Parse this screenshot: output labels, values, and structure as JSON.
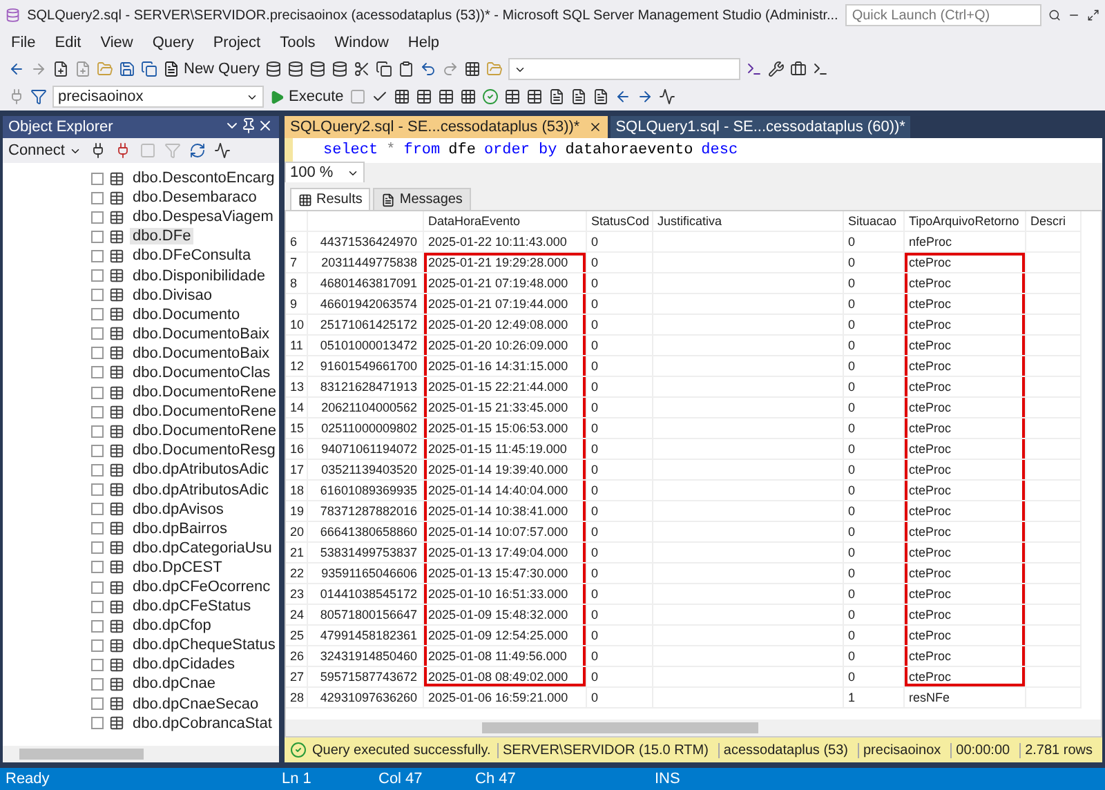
{
  "window": {
    "title": "SQLQuery2.sql - SERVER\\SERVIDOR.precisaoinox (acessodataplus (53))* - Microsoft SQL Server Management Studio (Administr..."
  },
  "quick_launch": {
    "placeholder": "Quick Launch (Ctrl+Q)"
  },
  "menu": [
    "File",
    "Edit",
    "View",
    "Query",
    "Project",
    "Tools",
    "Window",
    "Help"
  ],
  "toolbar": {
    "new_query": "New Query",
    "database": "precisaoinox",
    "execute": "Execute"
  },
  "object_explorer": {
    "title": "Object Explorer",
    "connect": "Connect",
    "items": [
      {
        "label": "dbo.DescontoEncarg",
        "selected": false
      },
      {
        "label": "dbo.Desembaraco",
        "selected": false
      },
      {
        "label": "dbo.DespesaViagem",
        "selected": false
      },
      {
        "label": "dbo.DFe",
        "selected": true
      },
      {
        "label": "dbo.DFeConsulta",
        "selected": false
      },
      {
        "label": "dbo.Disponibilidade",
        "selected": false
      },
      {
        "label": "dbo.Divisao",
        "selected": false
      },
      {
        "label": "dbo.Documento",
        "selected": false
      },
      {
        "label": "dbo.DocumentoBaix",
        "selected": false
      },
      {
        "label": "dbo.DocumentoBaix",
        "selected": false
      },
      {
        "label": "dbo.DocumentoClas",
        "selected": false
      },
      {
        "label": "dbo.DocumentoRene",
        "selected": false
      },
      {
        "label": "dbo.DocumentoRene",
        "selected": false
      },
      {
        "label": "dbo.DocumentoRene",
        "selected": false
      },
      {
        "label": "dbo.DocumentoResg",
        "selected": false
      },
      {
        "label": "dbo.dpAtributosAdic",
        "selected": false
      },
      {
        "label": "dbo.dpAtributosAdic",
        "selected": false
      },
      {
        "label": "dbo.dpAvisos",
        "selected": false
      },
      {
        "label": "dbo.dpBairros",
        "selected": false
      },
      {
        "label": "dbo.dpCategoriaUsu",
        "selected": false
      },
      {
        "label": "dbo.DpCEST",
        "selected": false
      },
      {
        "label": "dbo.dpCFeOcorrenc",
        "selected": false
      },
      {
        "label": "dbo.dpCFeStatus",
        "selected": false
      },
      {
        "label": "dbo.dpCfop",
        "selected": false
      },
      {
        "label": "dbo.dpChequeStatus",
        "selected": false
      },
      {
        "label": "dbo.dpCidades",
        "selected": false
      },
      {
        "label": "dbo.dpCnae",
        "selected": false
      },
      {
        "label": "dbo.dpCnaeSecao",
        "selected": false
      },
      {
        "label": "dbo.dpCobrancaStat",
        "selected": false
      }
    ]
  },
  "editor_tabs": [
    {
      "label": "SQLQuery2.sql - SE...cessodataplus (53))*",
      "selected": true
    },
    {
      "label": "SQLQuery1.sql - SE...cessodataplus (60))*",
      "selected": false
    }
  ],
  "query": [
    {
      "kind": "keyword",
      "text": "select"
    },
    {
      "kind": "operator",
      "text": "*"
    },
    {
      "kind": "keyword",
      "text": "from"
    },
    {
      "kind": "plain",
      "text": "dfe"
    },
    {
      "kind": "keyword",
      "text": "order by"
    },
    {
      "kind": "plain",
      "text": "datahoraevento"
    },
    {
      "kind": "keyword",
      "text": "desc"
    }
  ],
  "zoom": "100 %",
  "result_tabs": [
    {
      "label": "Results",
      "selected": true
    },
    {
      "label": "Messages",
      "selected": false
    }
  ],
  "grid": {
    "columns": [
      null,
      "DataHoraEvento",
      "StatusCod",
      "Justificativa",
      "Situacao",
      "TipoArquivoRetorno",
      "Descri"
    ],
    "rows": [
      {
        "number": "6",
        "cells": [
          {
            "text": "44371536424970",
            "boxed": false
          },
          {
            "text": "2025-01-22 10:11:43.000",
            "boxed": false
          },
          {
            "text": "0",
            "boxed": false
          },
          {
            "boxed": false
          },
          {
            "text": "0",
            "boxed": false
          },
          {
            "text": "nfeProc",
            "boxed": false
          },
          {
            "boxed": false
          }
        ]
      },
      {
        "number": "7",
        "cells": [
          {
            "text": "20311449775838",
            "boxed": false
          },
          {
            "text": "2025-01-21 19:29:28.000",
            "boxed": true
          },
          {
            "text": "0",
            "boxed": false
          },
          {
            "boxed": false
          },
          {
            "text": "0",
            "boxed": false
          },
          {
            "text": "cteProc",
            "boxed": true
          },
          {
            "boxed": false
          }
        ]
      },
      {
        "number": "8",
        "cells": [
          {
            "text": "46801463817091",
            "boxed": false
          },
          {
            "text": "2025-01-21 07:19:48.000",
            "boxed": true
          },
          {
            "text": "0",
            "boxed": false
          },
          {
            "boxed": false
          },
          {
            "text": "0",
            "boxed": false
          },
          {
            "text": "cteProc",
            "boxed": true
          },
          {
            "boxed": false
          }
        ]
      },
      {
        "number": "9",
        "cells": [
          {
            "text": "46601942063574",
            "boxed": false
          },
          {
            "text": "2025-01-21 07:19:44.000",
            "boxed": true
          },
          {
            "text": "0",
            "boxed": false
          },
          {
            "boxed": false
          },
          {
            "text": "0",
            "boxed": false
          },
          {
            "text": "cteProc",
            "boxed": true
          },
          {
            "boxed": false
          }
        ]
      },
      {
        "number": "10",
        "cells": [
          {
            "text": "25171061425172",
            "boxed": false
          },
          {
            "text": "2025-01-20 12:49:08.000",
            "boxed": true
          },
          {
            "text": "0",
            "boxed": false
          },
          {
            "boxed": false
          },
          {
            "text": "0",
            "boxed": false
          },
          {
            "text": "cteProc",
            "boxed": true
          },
          {
            "boxed": false
          }
        ]
      },
      {
        "number": "11",
        "cells": [
          {
            "text": "05101000013472",
            "boxed": false
          },
          {
            "text": "2025-01-20 10:26:09.000",
            "boxed": true
          },
          {
            "text": "0",
            "boxed": false
          },
          {
            "boxed": false
          },
          {
            "text": "0",
            "boxed": false
          },
          {
            "text": "cteProc",
            "boxed": true
          },
          {
            "boxed": false
          }
        ]
      },
      {
        "number": "12",
        "cells": [
          {
            "text": "91601549661700",
            "boxed": false
          },
          {
            "text": "2025-01-16 14:31:15.000",
            "boxed": true
          },
          {
            "text": "0",
            "boxed": false
          },
          {
            "boxed": false
          },
          {
            "text": "0",
            "boxed": false
          },
          {
            "text": "cteProc",
            "boxed": true
          },
          {
            "boxed": false
          }
        ]
      },
      {
        "number": "13",
        "cells": [
          {
            "text": "83121628471913",
            "boxed": false
          },
          {
            "text": "2025-01-15 22:21:44.000",
            "boxed": true
          },
          {
            "text": "0",
            "boxed": false
          },
          {
            "boxed": false
          },
          {
            "text": "0",
            "boxed": false
          },
          {
            "text": "cteProc",
            "boxed": true
          },
          {
            "boxed": false
          }
        ]
      },
      {
        "number": "14",
        "cells": [
          {
            "text": "20621104000562",
            "boxed": false
          },
          {
            "text": "2025-01-15 21:33:45.000",
            "boxed": true
          },
          {
            "text": "0",
            "boxed": false
          },
          {
            "boxed": false
          },
          {
            "text": "0",
            "boxed": false
          },
          {
            "text": "cteProc",
            "boxed": true
          },
          {
            "boxed": false
          }
        ]
      },
      {
        "number": "15",
        "cells": [
          {
            "text": "02511000009802",
            "boxed": false
          },
          {
            "text": "2025-01-15 15:06:53.000",
            "boxed": true
          },
          {
            "text": "0",
            "boxed": false
          },
          {
            "boxed": false
          },
          {
            "text": "0",
            "boxed": false
          },
          {
            "text": "cteProc",
            "boxed": true
          },
          {
            "boxed": false
          }
        ]
      },
      {
        "number": "16",
        "cells": [
          {
            "text": "94071061194072",
            "boxed": false
          },
          {
            "text": "2025-01-15 11:45:19.000",
            "boxed": true
          },
          {
            "text": "0",
            "boxed": false
          },
          {
            "boxed": false
          },
          {
            "text": "0",
            "boxed": false
          },
          {
            "text": "cteProc",
            "boxed": true
          },
          {
            "boxed": false
          }
        ]
      },
      {
        "number": "17",
        "cells": [
          {
            "text": "03521139403520",
            "boxed": false
          },
          {
            "text": "2025-01-14 19:39:40.000",
            "boxed": true
          },
          {
            "text": "0",
            "boxed": false
          },
          {
            "boxed": false
          },
          {
            "text": "0",
            "boxed": false
          },
          {
            "text": "cteProc",
            "boxed": true
          },
          {
            "boxed": false
          }
        ]
      },
      {
        "number": "18",
        "cells": [
          {
            "text": "61601089369935",
            "boxed": false
          },
          {
            "text": "2025-01-14 14:40:04.000",
            "boxed": true
          },
          {
            "text": "0",
            "boxed": false
          },
          {
            "boxed": false
          },
          {
            "text": "0",
            "boxed": false
          },
          {
            "text": "cteProc",
            "boxed": true
          },
          {
            "boxed": false
          }
        ]
      },
      {
        "number": "19",
        "cells": [
          {
            "text": "78371287882016",
            "boxed": false
          },
          {
            "text": "2025-01-14 10:38:41.000",
            "boxed": true
          },
          {
            "text": "0",
            "boxed": false
          },
          {
            "boxed": false
          },
          {
            "text": "0",
            "boxed": false
          },
          {
            "text": "cteProc",
            "boxed": true
          },
          {
            "boxed": false
          }
        ]
      },
      {
        "number": "20",
        "cells": [
          {
            "text": "66641380658860",
            "boxed": false
          },
          {
            "text": "2025-01-14 10:07:57.000",
            "boxed": true
          },
          {
            "text": "0",
            "boxed": false
          },
          {
            "boxed": false
          },
          {
            "text": "0",
            "boxed": false
          },
          {
            "text": "cteProc",
            "boxed": true
          },
          {
            "boxed": false
          }
        ]
      },
      {
        "number": "21",
        "cells": [
          {
            "text": "53831499753837",
            "boxed": false
          },
          {
            "text": "2025-01-13 17:49:04.000",
            "boxed": true
          },
          {
            "text": "0",
            "boxed": false
          },
          {
            "boxed": false
          },
          {
            "text": "0",
            "boxed": false
          },
          {
            "text": "cteProc",
            "boxed": true
          },
          {
            "boxed": false
          }
        ]
      },
      {
        "number": "22",
        "cells": [
          {
            "text": "93591165046606",
            "boxed": false
          },
          {
            "text": "2025-01-13 15:47:30.000",
            "boxed": true
          },
          {
            "text": "0",
            "boxed": false
          },
          {
            "boxed": false
          },
          {
            "text": "0",
            "boxed": false
          },
          {
            "text": "cteProc",
            "boxed": true
          },
          {
            "boxed": false
          }
        ]
      },
      {
        "number": "23",
        "cells": [
          {
            "text": "01441038545172",
            "boxed": false
          },
          {
            "text": "2025-01-10 16:51:33.000",
            "boxed": true
          },
          {
            "text": "0",
            "boxed": false
          },
          {
            "boxed": false
          },
          {
            "text": "0",
            "boxed": false
          },
          {
            "text": "cteProc",
            "boxed": true
          },
          {
            "boxed": false
          }
        ]
      },
      {
        "number": "24",
        "cells": [
          {
            "text": "80571800156647",
            "boxed": false
          },
          {
            "text": "2025-01-09 15:48:32.000",
            "boxed": true
          },
          {
            "text": "0",
            "boxed": false
          },
          {
            "boxed": false
          },
          {
            "text": "0",
            "boxed": false
          },
          {
            "text": "cteProc",
            "boxed": true
          },
          {
            "boxed": false
          }
        ]
      },
      {
        "number": "25",
        "cells": [
          {
            "text": "47991458182361",
            "boxed": false
          },
          {
            "text": "2025-01-09 12:54:25.000",
            "boxed": true
          },
          {
            "text": "0",
            "boxed": false
          },
          {
            "boxed": false
          },
          {
            "text": "0",
            "boxed": false
          },
          {
            "text": "cteProc",
            "boxed": true
          },
          {
            "boxed": false
          }
        ]
      },
      {
        "number": "26",
        "cells": [
          {
            "text": "32431914850460",
            "boxed": false
          },
          {
            "text": "2025-01-08 11:49:56.000",
            "boxed": true
          },
          {
            "text": "0",
            "boxed": false
          },
          {
            "boxed": false
          },
          {
            "text": "0",
            "boxed": false
          },
          {
            "text": "cteProc",
            "boxed": true
          },
          {
            "boxed": false
          }
        ]
      },
      {
        "number": "27",
        "cells": [
          {
            "text": "59571587743672",
            "boxed": false
          },
          {
            "text": "2025-01-08 08:49:02.000",
            "boxed": true
          },
          {
            "text": "0",
            "boxed": false
          },
          {
            "boxed": false
          },
          {
            "text": "0",
            "boxed": false
          },
          {
            "text": "cteProc",
            "boxed": true
          },
          {
            "boxed": false
          }
        ]
      },
      {
        "number": "28",
        "cells": [
          {
            "text": "42931097636260",
            "boxed": false
          },
          {
            "text": "2025-01-06 16:59:21.000",
            "boxed": false
          },
          {
            "text": "0",
            "boxed": false
          },
          {
            "boxed": false
          },
          {
            "text": "1",
            "boxed": false
          },
          {
            "text": "resNFe",
            "boxed": false
          },
          {
            "boxed": false
          }
        ]
      }
    ]
  },
  "query_status": {
    "success": true,
    "message": "Query executed successfully.",
    "fields": [
      "SERVER\\SERVIDOR (15.0 RTM)",
      "acessodataplus (53)",
      "precisaoinox",
      "00:00:00",
      "2.781 rows"
    ]
  },
  "status_bar": {
    "state": "Ready",
    "fields": [
      "Ln 1",
      "Col 47",
      "Ch 47",
      "INS"
    ]
  }
}
